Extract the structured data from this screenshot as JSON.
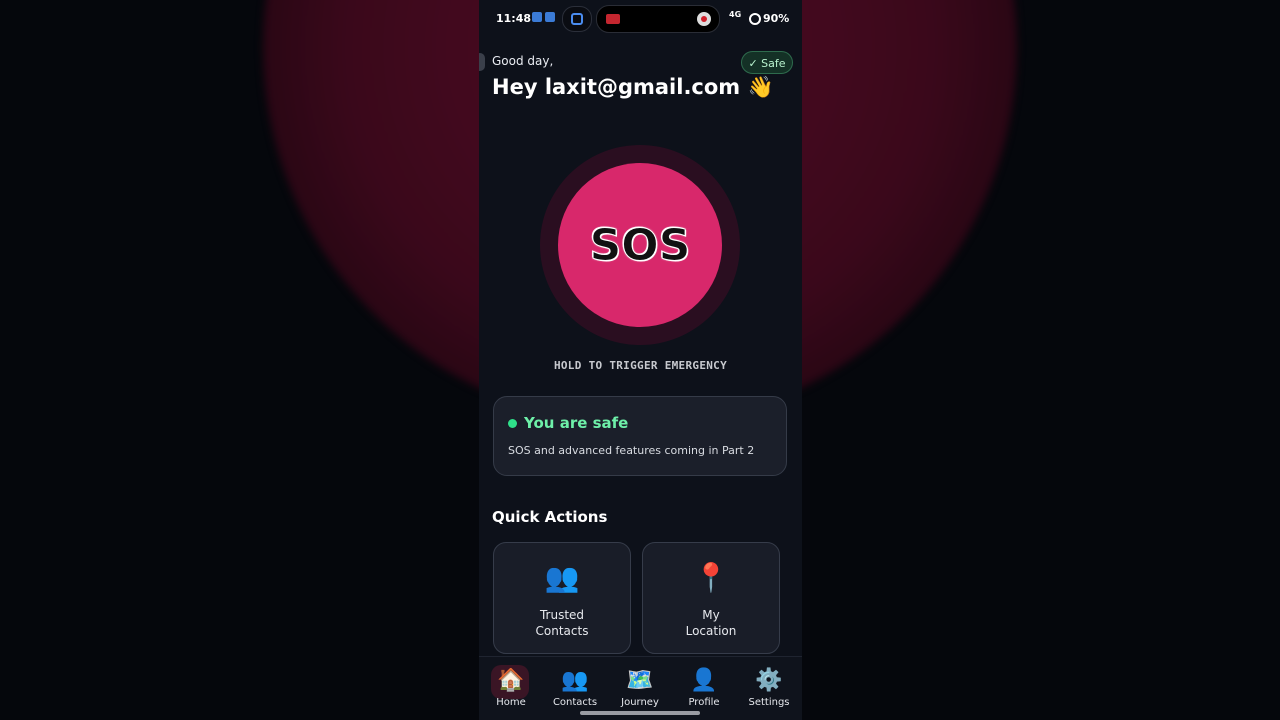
{
  "status_bar": {
    "time": "11:48",
    "network": "4G",
    "battery": "90%"
  },
  "header": {
    "greeting": "Good day,",
    "title": "Hey laxit@gmail.com 👋",
    "badge": "✓ Safe"
  },
  "sos": {
    "button_label": "SOS",
    "hint": "HOLD TO TRIGGER EMERGENCY"
  },
  "status_card": {
    "title": "You are safe",
    "subtitle": "SOS and advanced features coming in Part 2"
  },
  "quick_actions": {
    "heading": "Quick Actions",
    "items": [
      {
        "icon": "contacts-icon",
        "glyph": "👥",
        "label_line1": "Trusted",
        "label_line2": "Contacts"
      },
      {
        "icon": "location-pin-icon",
        "glyph": "📍",
        "label_line1": "My",
        "label_line2": "Location"
      }
    ]
  },
  "nav": {
    "items": [
      {
        "icon": "home-icon",
        "glyph": "🏠",
        "label": "Home",
        "active": true
      },
      {
        "icon": "contacts-icon",
        "glyph": "👥",
        "label": "Contacts",
        "active": false
      },
      {
        "icon": "map-icon",
        "glyph": "🗺️",
        "label": "Journey",
        "active": false
      },
      {
        "icon": "profile-icon",
        "glyph": "👤",
        "label": "Profile",
        "active": false
      },
      {
        "icon": "gear-icon",
        "glyph": "⚙️",
        "label": "Settings",
        "active": false
      }
    ]
  },
  "background": {
    "hold_text": "HOLD TO TRIGGER EMERGENCY",
    "card_title": "You are safe",
    "card_subtitle": "SOS and advanced features coming in Part 2"
  },
  "colors": {
    "sos": "#d8286b",
    "safe_green": "#2fe08a",
    "background": "#0d111a",
    "card": "#1b1f2a"
  }
}
